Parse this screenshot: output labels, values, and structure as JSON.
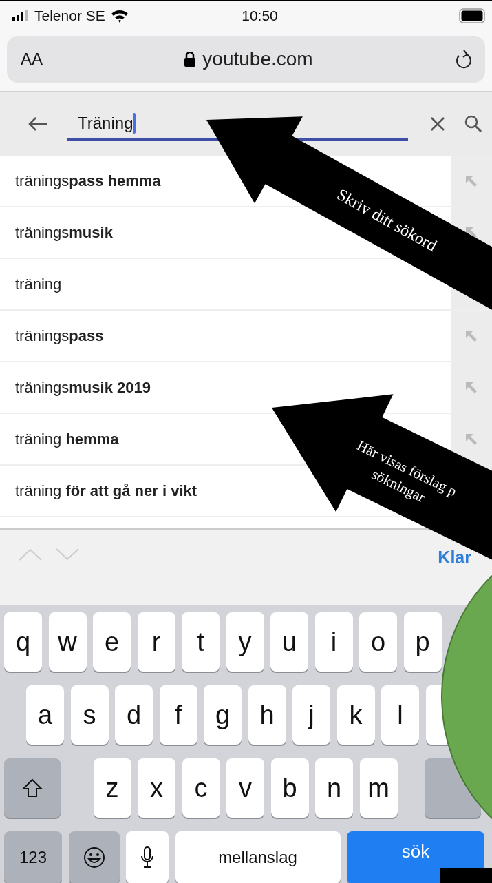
{
  "status_bar": {
    "carrier": "Telenor SE",
    "time": "10:50"
  },
  "address_bar": {
    "text_size": "AA",
    "url": "youtube.com"
  },
  "search": {
    "value": "Träning"
  },
  "suggestions": [
    {
      "text": "tränings**pass hemma**"
    },
    {
      "text": "tränings**musik**"
    },
    {
      "text": "träning"
    },
    {
      "text": "tränings**pass**"
    },
    {
      "text": "tränings**musik 2019**"
    },
    {
      "text": "träning **hemma**"
    },
    {
      "text": "träning **för att gå ner i vikt**"
    }
  ],
  "keyboard": {
    "done": "Klar",
    "rows": [
      [
        "q",
        "w",
        "e",
        "r",
        "t",
        "y",
        "u",
        "i",
        "o",
        "p"
      ],
      [
        "a",
        "s",
        "d",
        "f",
        "g",
        "h",
        "j",
        "k",
        "l"
      ],
      [
        "z",
        "x",
        "c",
        "v",
        "b",
        "n",
        "m"
      ]
    ],
    "numbers_key": "123",
    "space_key": "mellanslag",
    "search_key": "sök"
  },
  "annotations": [
    {
      "lines": [
        "Skriv ditt sökord"
      ]
    },
    {
      "lines": [
        "Här visas förslag p",
        "sökningar"
      ]
    }
  ]
}
